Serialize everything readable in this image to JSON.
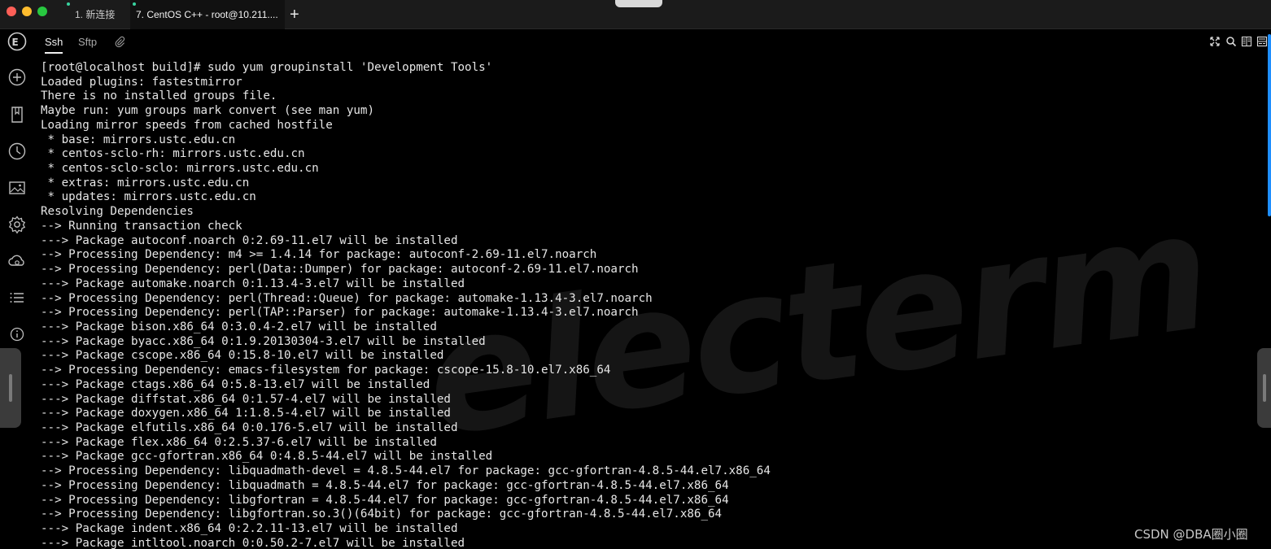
{
  "titlebar": {
    "tabs": [
      {
        "label": "1. 新连接",
        "active": false
      },
      {
        "label": "7. CentOS C++ - root@10.211....",
        "active": true
      }
    ],
    "new_tab_label": "+"
  },
  "sidebar": {
    "logo": "E",
    "icons": [
      "add-bookmark-icon",
      "bookmarks-icon",
      "history-icon",
      "image-icon",
      "settings-icon",
      "cloud-sync-icon",
      "batch-list-icon",
      "info-icon"
    ]
  },
  "session_tabs": {
    "ssh": "Ssh",
    "sftp": "Sftp",
    "attach_icon": "paperclip-icon",
    "tools": [
      "fullscreen-icon",
      "search-icon",
      "split-vertical-icon",
      "split-horizontal-icon"
    ]
  },
  "terminal": {
    "watermark": "electerm",
    "accent_color": "#1f8fff",
    "lines": [
      "[root@localhost build]# sudo yum groupinstall 'Development Tools'",
      "Loaded plugins: fastestmirror",
      "There is no installed groups file.",
      "Maybe run: yum groups mark convert (see man yum)",
      "Loading mirror speeds from cached hostfile",
      " * base: mirrors.ustc.edu.cn",
      " * centos-sclo-rh: mirrors.ustc.edu.cn",
      " * centos-sclo-sclo: mirrors.ustc.edu.cn",
      " * extras: mirrors.ustc.edu.cn",
      " * updates: mirrors.ustc.edu.cn",
      "Resolving Dependencies",
      "--> Running transaction check",
      "---> Package autoconf.noarch 0:2.69-11.el7 will be installed",
      "--> Processing Dependency: m4 >= 1.4.14 for package: autoconf-2.69-11.el7.noarch",
      "--> Processing Dependency: perl(Data::Dumper) for package: autoconf-2.69-11.el7.noarch",
      "---> Package automake.noarch 0:1.13.4-3.el7 will be installed",
      "--> Processing Dependency: perl(Thread::Queue) for package: automake-1.13.4-3.el7.noarch",
      "--> Processing Dependency: perl(TAP::Parser) for package: automake-1.13.4-3.el7.noarch",
      "---> Package bison.x86_64 0:3.0.4-2.el7 will be installed",
      "---> Package byacc.x86_64 0:1.9.20130304-3.el7 will be installed",
      "---> Package cscope.x86_64 0:15.8-10.el7 will be installed",
      "--> Processing Dependency: emacs-filesystem for package: cscope-15.8-10.el7.x86_64",
      "---> Package ctags.x86_64 0:5.8-13.el7 will be installed",
      "---> Package diffstat.x86_64 0:1.57-4.el7 will be installed",
      "---> Package doxygen.x86_64 1:1.8.5-4.el7 will be installed",
      "---> Package elfutils.x86_64 0:0.176-5.el7 will be installed",
      "---> Package flex.x86_64 0:2.5.37-6.el7 will be installed",
      "---> Package gcc-gfortran.x86_64 0:4.8.5-44.el7 will be installed",
      "--> Processing Dependency: libquadmath-devel = 4.8.5-44.el7 for package: gcc-gfortran-4.8.5-44.el7.x86_64",
      "--> Processing Dependency: libquadmath = 4.8.5-44.el7 for package: gcc-gfortran-4.8.5-44.el7.x86_64",
      "--> Processing Dependency: libgfortran = 4.8.5-44.el7 for package: gcc-gfortran-4.8.5-44.el7.x86_64",
      "--> Processing Dependency: libgfortran.so.3()(64bit) for package: gcc-gfortran-4.8.5-44.el7.x86_64",
      "---> Package indent.x86_64 0:2.2.11-13.el7 will be installed",
      "---> Package intltool.noarch 0:0.50.2-7.el7 will be installed"
    ]
  },
  "credit": "CSDN @DBA圈小圈"
}
